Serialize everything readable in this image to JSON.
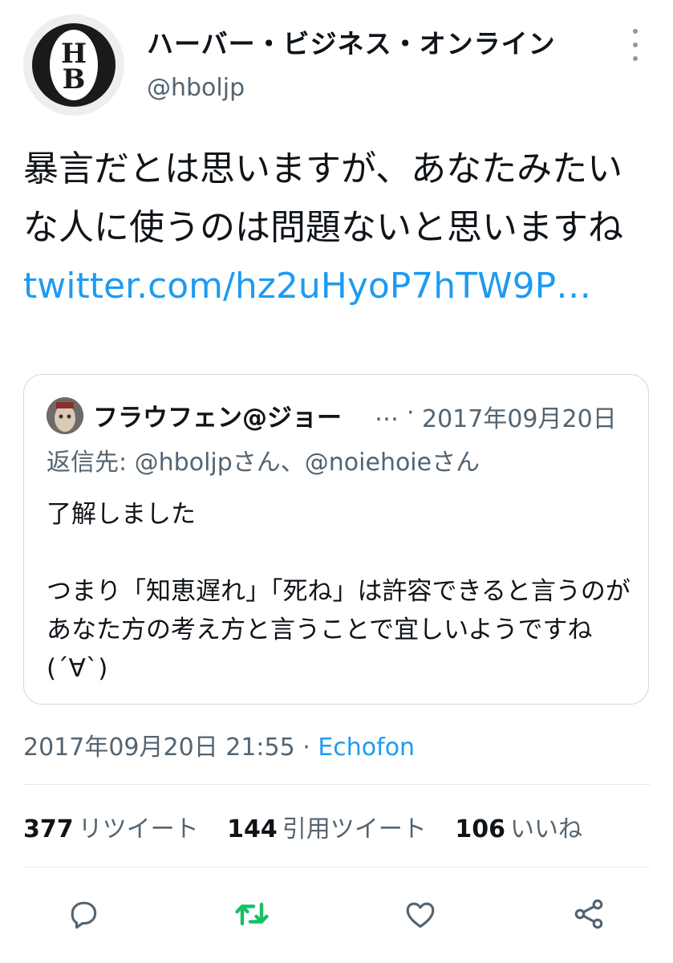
{
  "tweet": {
    "author": {
      "display_name": "ハーバー・ビジネス・オンライン",
      "handle": "@hboljp",
      "avatar_letters": "HB"
    },
    "text": "暴言だとは思いますが、あなたみたいな人に使うのは問題ないと思いますね",
    "link": "twitter.com/hz2uHyoP7hTW9P…",
    "timestamp": "2017年09月20日 21:55",
    "separator": "·",
    "source": "Echofon"
  },
  "quote": {
    "author_name": "フラウフェン@ジョー",
    "ellipsis": "…",
    "separator": "·",
    "date": "2017年09月20日",
    "reply_label": "返信先: ",
    "reply_to_1": "@hboljpさん",
    "reply_joiner": "、",
    "reply_to_2": "@noiehoieさん",
    "line_1": "了解しました",
    "line_2": "つまり「知恵遅れ」「死ね」は許容できると言うのがあなた方の考え方と言うことで宜しいようですね(´∀`)"
  },
  "stats": {
    "retweets": {
      "count": "377",
      "label": "リツイート"
    },
    "quotes": {
      "count": "144",
      "label": "引用ツイート"
    },
    "likes": {
      "count": "106",
      "label": "いいね"
    }
  },
  "actions": {
    "reply_icon": "reply-icon",
    "retweet_icon": "retweet-icon",
    "like_icon": "like-icon",
    "share_icon": "share-icon",
    "retweet_color": "#17bf63",
    "icon_color": "#536471"
  },
  "colors": {
    "link": "#1d9bf0",
    "secondary": "#536471",
    "border": "#cfd9de"
  }
}
